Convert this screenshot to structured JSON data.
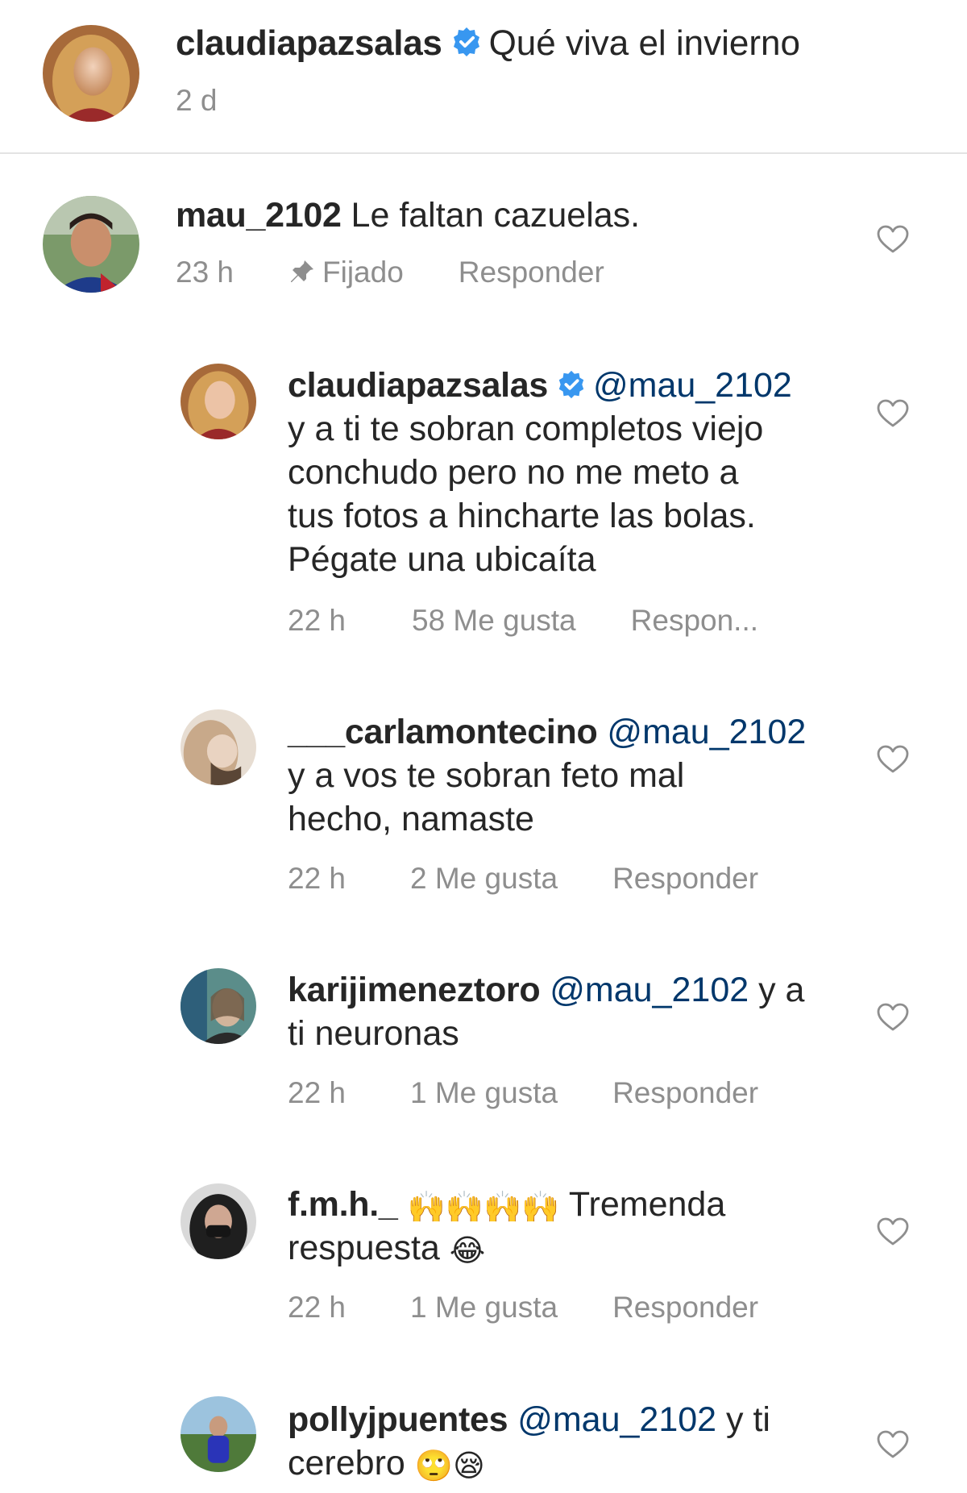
{
  "post": {
    "username": "claudiapazsalas",
    "verified": true,
    "caption": "Qué viva el invierno",
    "time": "2 d"
  },
  "comments": [
    {
      "username": "mau_2102",
      "text": "Le faltan cazuelas.",
      "time": "23 h",
      "pinned_label": "Fijado",
      "reply_label": "Responder",
      "icon": "heart-outline-icon"
    }
  ],
  "replies": [
    {
      "username": "claudiapazsalas",
      "verified": true,
      "mention": "@mau_2102",
      "lines": [
        "y a ti te sobran completos viejo",
        "conchudo pero no me meto a",
        "tus fotos a hincharte las bolas.",
        "Pégate una ubicaíta"
      ],
      "time": "22 h",
      "likes": "58 Me gusta",
      "reply_label": "Respon..."
    },
    {
      "username": "___carlamontecino",
      "mention": "@mau_2102",
      "lines": [
        "y a vos te sobran feto mal",
        "hecho, namaste"
      ],
      "time": "22 h",
      "likes": "2 Me gusta",
      "reply_label": "Responder"
    },
    {
      "username": "karijimeneztoro",
      "mention": "@mau_2102",
      "after_mention": "y a",
      "lines": [
        "ti neuronas"
      ],
      "time": "22 h",
      "likes": "1 Me gusta",
      "reply_label": "Responder"
    },
    {
      "username": "f.m.h._",
      "emojis": "🙌🙌🙌🙌",
      "text_after": "Tremenda",
      "lines": [
        "respuesta"
      ],
      "line_emoji": "😂",
      "time": "22 h",
      "likes": "1 Me gusta",
      "reply_label": "Responder"
    },
    {
      "username": "pollyjpuentes",
      "mention": "@mau_2102",
      "after_mention": "y ti",
      "lines": [
        "cerebro"
      ],
      "line_emoji": "🙄😪"
    }
  ],
  "colors": {
    "text": "#262626",
    "secondary": "#8e8e8e",
    "mention": "#00376b",
    "verified": "#3897f0",
    "divider": "#e3e3e3"
  }
}
